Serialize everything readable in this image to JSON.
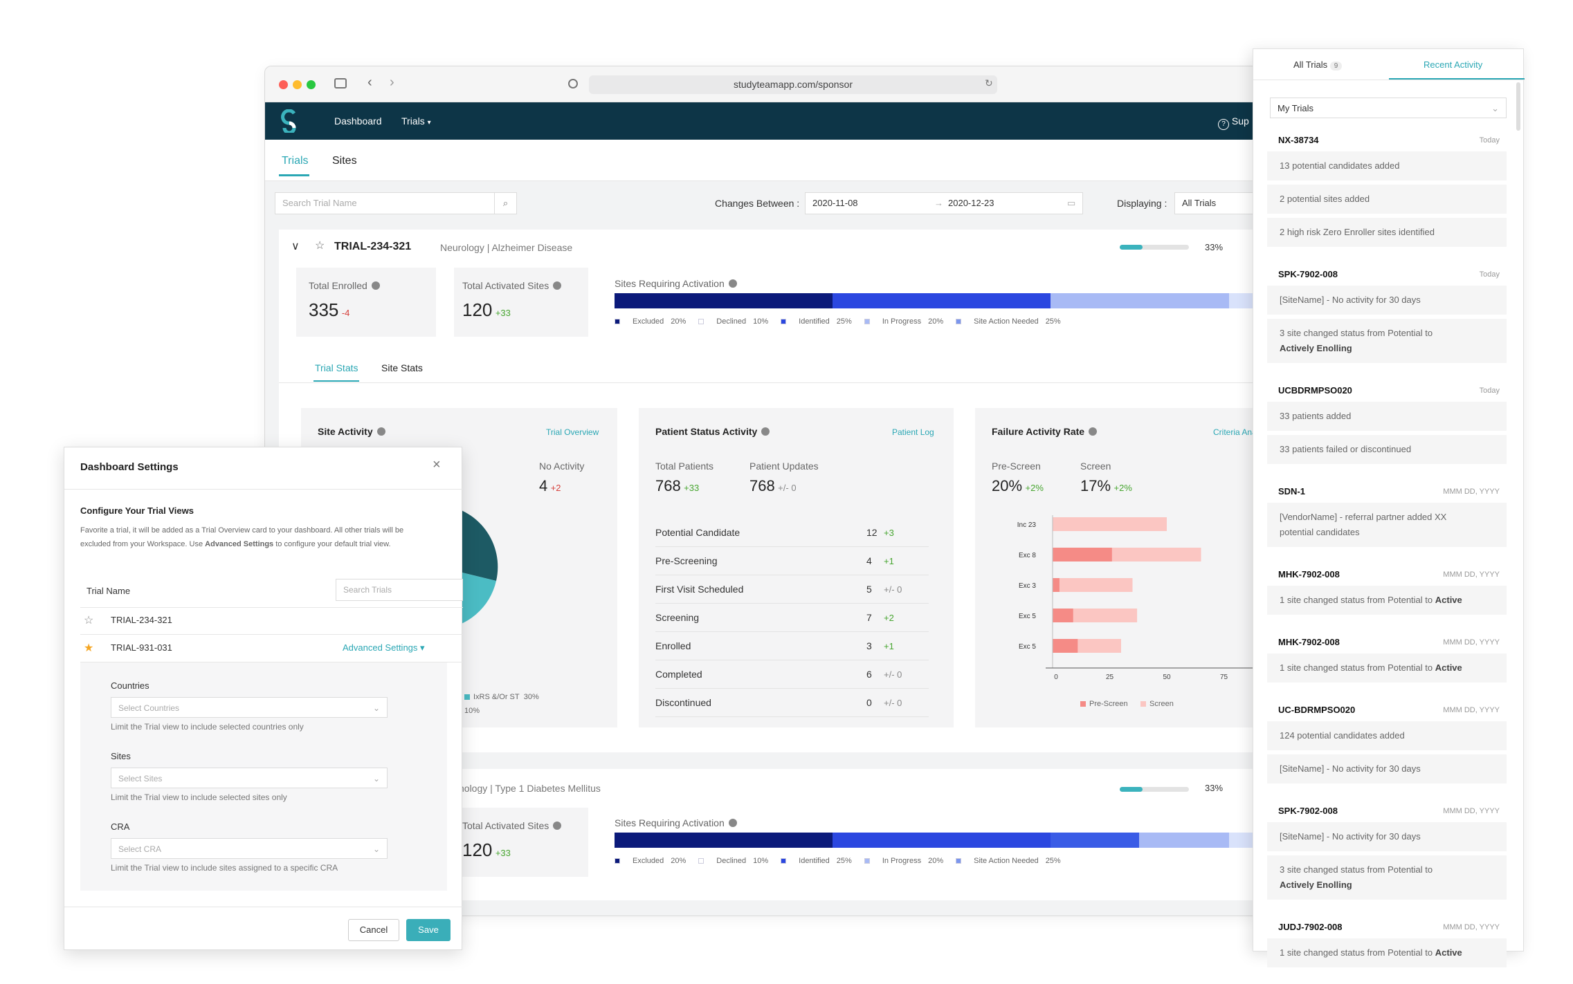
{
  "browser": {
    "url": "studyteamapp.com/sponsor"
  },
  "nav": {
    "dashboard": "Dashboard",
    "trials": "Trials",
    "support": "Sup"
  },
  "tabs": {
    "trials": "Trials",
    "sites": "Sites"
  },
  "filters": {
    "search_placeholder": "Search Trial Name",
    "changes_between": "Changes Between :",
    "date_from": "2020-11-08",
    "date_to": "2020-12-23",
    "displaying": "Displaying :",
    "displaying_value": "All Trials"
  },
  "trial1": {
    "id": "TRIAL-234-321",
    "subtitle": "Neurology | Alzheimer Disease",
    "progress_label": "33%",
    "progress": 0.33,
    "total_enrolled_label": "Total Enrolled",
    "total_enrolled": "335",
    "total_enrolled_delta": "-4",
    "activated_label": "Total Activated Sites",
    "activated": "120",
    "activated_delta": "+33",
    "sites_req_label": "Sites Requiring Activation"
  },
  "legend": [
    {
      "name": "Excluded",
      "pct": "20%",
      "color": "#0b1a7a"
    },
    {
      "name": "Declined",
      "pct": "10%",
      "color": "#ffffff"
    },
    {
      "name": "Identified",
      "pct": "25%",
      "color": "#2b47e0"
    },
    {
      "name": "In Progress",
      "pct": "20%",
      "color": "#a8baf5"
    },
    {
      "name": "Site Action Needed",
      "pct": "25%",
      "color": "#7b96ee"
    }
  ],
  "stat_tabs": {
    "trial": "Trial Stats",
    "site": "Site Stats"
  },
  "site_activity": {
    "title": "Site Activity",
    "link": "Trial Overview",
    "no_activity_label": "No Activity",
    "no_activity": "4",
    "no_activity_delta": "+2",
    "legend_label": "IxRS &/Or ST",
    "legend_pct": "30%",
    "legend_pct2": "10%"
  },
  "patient_status": {
    "title": "Patient Status Activity",
    "link": "Patient Log",
    "total_label": "Total Patients",
    "total": "768",
    "total_delta": "+33",
    "updates_label": "Patient Updates",
    "updates": "768",
    "updates_delta": "+/- 0",
    "rows": [
      {
        "label": "Potential Candidate",
        "value": "12",
        "delta": "+3",
        "kind": "pos"
      },
      {
        "label": "Pre-Screening",
        "value": "4",
        "delta": "+1",
        "kind": "pos"
      },
      {
        "label": "First Visit Scheduled",
        "value": "5",
        "delta": "+/- 0",
        "kind": "neu"
      },
      {
        "label": "Screening",
        "value": "7",
        "delta": "+2",
        "kind": "pos"
      },
      {
        "label": "Enrolled",
        "value": "3",
        "delta": "+1",
        "kind": "pos"
      },
      {
        "label": "Completed",
        "value": "6",
        "delta": "+/- 0",
        "kind": "neu"
      },
      {
        "label": "Discontinued",
        "value": "0",
        "delta": "+/- 0",
        "kind": "neu"
      }
    ]
  },
  "failure": {
    "title": "Failure Activity Rate",
    "link": "Criteria Ana",
    "pre_label": "Pre-Screen",
    "pre": "20%",
    "pre_delta": "+2%",
    "screen_label": "Screen",
    "screen": "17%",
    "screen_delta": "+2%",
    "legend_pre": "Pre-Screen",
    "legend_screen": "Screen"
  },
  "chart_data": {
    "type": "bar",
    "categories": [
      "Inc 23",
      "Exc 8",
      "Exc 3",
      "Exc 5",
      "Exc 5"
    ],
    "series": [
      {
        "name": "Pre-Screen",
        "values": [
          0,
          26,
          3,
          9,
          11
        ]
      },
      {
        "name": "Screen",
        "values": [
          50,
          39,
          32,
          28,
          19
        ]
      }
    ],
    "xticks": [
      "0",
      "25",
      "50",
      "75"
    ],
    "xlim": [
      0,
      100
    ]
  },
  "trial2": {
    "subtitle": "nology | Type 1 Diabetes Mellitus",
    "progress_label": "33%",
    "activated_label": "Total Activated Sites",
    "activated": "120",
    "activated_delta": "+33",
    "sites_req_label": "Sites Requiring Activation"
  },
  "modal": {
    "title": "Dashboard Settings",
    "section_title": "Configure Your Trial Views",
    "desc1": "Favorite a trial, it will be added as a Trial Overview card to your dashboard. All other trials will be",
    "desc2a": "excluded from your Workspace. Use ",
    "desc2b": "Advanced Settings",
    "desc2c": " to configure your default trial view.",
    "col": "Trial Name",
    "search_placeholder": "Search Trials",
    "trials": [
      "TRIAL-234-321",
      "TRIAL-931-031"
    ],
    "advanced": "Advanced Settings",
    "countries_label": "Countries",
    "countries_placeholder": "Select Countries",
    "countries_help": "Limit the Trial view to include selected countries only",
    "sites_label": "Sites",
    "sites_placeholder": "Select Sites",
    "sites_help": "Limit the Trial view to include selected sites only",
    "cra_label": "CRA",
    "cra_placeholder": "Select CRA",
    "cra_help": "Limit the Trial view to include sites assigned to a specific CRA",
    "cancel": "Cancel",
    "save": "Save"
  },
  "panel": {
    "tab_all": "All Trials",
    "tab_all_count": "9",
    "tab_recent": "Recent Activity",
    "filter": "My Trials",
    "groups": [
      {
        "title": "NX-38734",
        "date": "Today",
        "items": [
          "13 potential candidates added",
          "2 potential sites added",
          "2 high risk Zero Enroller sites identified"
        ]
      },
      {
        "title": "SPK-7902-008",
        "date": "Today",
        "items": [
          "[SiteName] - No activity for 30 days",
          "3 site changed status from Potential to"
        ],
        "bold": "Actively Enolling"
      },
      {
        "title": "UCBDRMPSO020",
        "date": "Today",
        "items": [
          "33 patients added",
          "33 patients failed or discontinued"
        ]
      },
      {
        "title": "SDN-1",
        "date": "MMM DD, YYYY",
        "items": [
          "[VendorName] - referral partner added XX"
        ],
        "extra": "potential candidates"
      },
      {
        "title": "MHK-7902-008",
        "date": "MMM DD, YYYY",
        "items": [
          "1 site changed status from Potential to "
        ],
        "bold_inline": "Active"
      },
      {
        "title": "MHK-7902-008",
        "date": "MMM DD, YYYY",
        "items": [
          "1 site changed status from Potential to "
        ],
        "bold_inline": "Active"
      },
      {
        "title": "UC-BDRMPSO020",
        "date": "MMM DD, YYYY",
        "items": [
          "124 potential candidates added",
          "[SiteName] - No activity for 30 days"
        ]
      },
      {
        "title": "SPK-7902-008",
        "date": "MMM DD, YYYY",
        "items": [
          "[SiteName] - No activity for 30 days",
          "3 site changed status from Potential to"
        ],
        "bold": "Actively Enolling"
      },
      {
        "title": "JUDJ-7902-008",
        "date": "MMM DD, YYYY",
        "items": [
          "1 site changed status from Potential to "
        ],
        "bold_inline": "Active"
      }
    ]
  }
}
